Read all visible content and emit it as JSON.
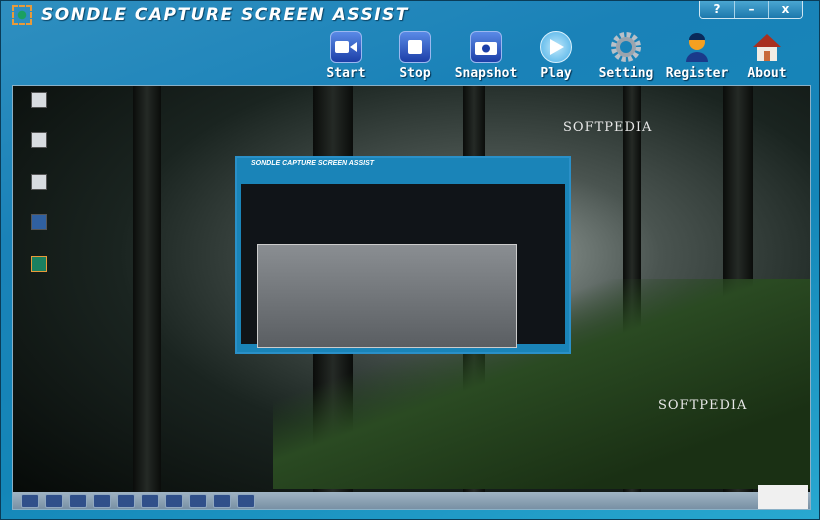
{
  "app": {
    "title": "SONDLE CAPTURE SCREEN ASSIST"
  },
  "window_controls": {
    "help": "?",
    "minimize": "–",
    "close": "x"
  },
  "toolbar": [
    {
      "label": "Start",
      "icon": "video-camera-icon"
    },
    {
      "label": "Stop",
      "icon": "stop-icon"
    },
    {
      "label": "Snapshot",
      "icon": "camera-icon"
    },
    {
      "label": "Play",
      "icon": "play-icon"
    },
    {
      "label": "Setting",
      "icon": "gear-icon"
    },
    {
      "label": "Register",
      "icon": "user-icon"
    },
    {
      "label": "About",
      "icon": "house-icon"
    }
  ],
  "preview": {
    "watermark1": "SOFTPEDIA",
    "watermark2": "SOFTPEDIA",
    "inner_title": "SONDLE CAPTURE SCREEN ASSIST"
  }
}
